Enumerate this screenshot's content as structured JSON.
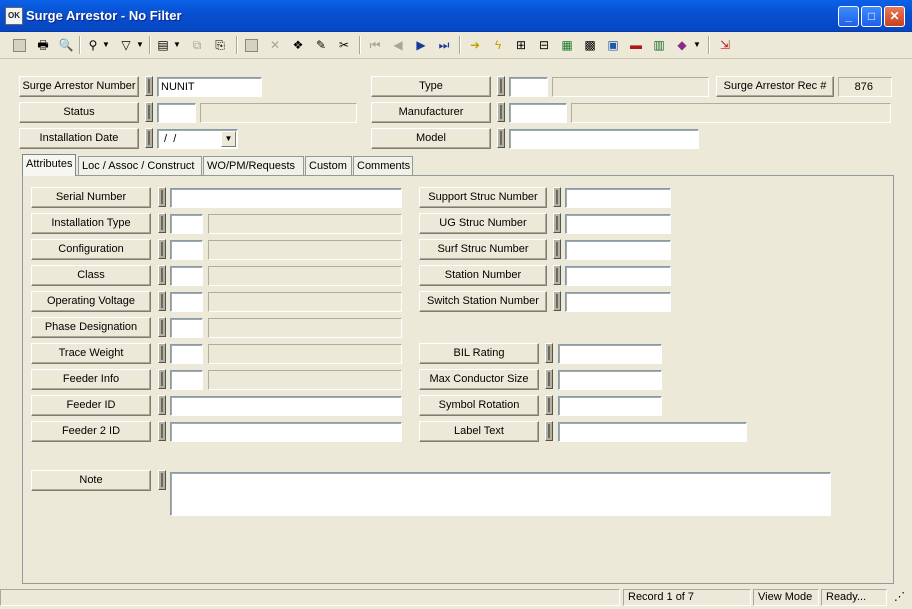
{
  "window": {
    "title": "Surge Arrestor - No Filter",
    "app_icon_text": "OK"
  },
  "header": {
    "surge_arrestor_number": {
      "label": "Surge Arrestor Number",
      "value": "NUNIT"
    },
    "status": {
      "label": "Status",
      "code": "",
      "desc": ""
    },
    "installation_date": {
      "label": "Installation Date",
      "value": " /  /"
    },
    "type": {
      "label": "Type",
      "code": "",
      "desc": ""
    },
    "manufacturer": {
      "label": "Manufacturer",
      "code": "",
      "desc": ""
    },
    "model": {
      "label": "Model",
      "value": ""
    },
    "rec_number": {
      "label": "Surge Arrestor Rec #",
      "value": "876"
    }
  },
  "tabs": [
    {
      "label": "Attributes",
      "active": true
    },
    {
      "label": "Loc / Assoc / Construct"
    },
    {
      "label": "WO/PM/Requests"
    },
    {
      "label": "Custom"
    },
    {
      "label": "Comments"
    }
  ],
  "attributes": {
    "serial_number": {
      "label": "Serial Number",
      "value": ""
    },
    "installation_type": {
      "label": "Installation Type",
      "code": "",
      "desc": ""
    },
    "configuration": {
      "label": "Configuration",
      "code": "",
      "desc": ""
    },
    "class": {
      "label": "Class",
      "code": "",
      "desc": ""
    },
    "operating_voltage": {
      "label": "Operating Voltage",
      "code": "",
      "desc": ""
    },
    "phase_designation": {
      "label": "Phase Designation",
      "code": "",
      "desc": ""
    },
    "trace_weight": {
      "label": "Trace Weight",
      "code": "",
      "desc": ""
    },
    "feeder_info": {
      "label": "Feeder Info",
      "code": "",
      "desc": ""
    },
    "feeder_id": {
      "label": "Feeder ID",
      "value": ""
    },
    "feeder_2_id": {
      "label": "Feeder 2 ID",
      "value": ""
    },
    "support_struc_number": {
      "label": "Support Struc Number",
      "value": ""
    },
    "ug_struc_number": {
      "label": "UG Struc Number",
      "value": ""
    },
    "surf_struc_number": {
      "label": "Surf Struc Number",
      "value": ""
    },
    "station_number": {
      "label": "Station Number",
      "value": ""
    },
    "switch_station_number": {
      "label": "Switch Station Number",
      "value": ""
    },
    "bil_rating": {
      "label": "BIL Rating",
      "value": ""
    },
    "max_conductor_size": {
      "label": "Max Conductor Size",
      "value": ""
    },
    "symbol_rotation": {
      "label": "Symbol Rotation",
      "value": ""
    },
    "label_text": {
      "label": "Label Text",
      "value": ""
    },
    "note": {
      "label": "Note",
      "value": ""
    }
  },
  "status_bar": {
    "record": "Record 1 of 7",
    "mode": "View Mode",
    "state": "Ready..."
  },
  "colors": {
    "title_bar": "#0a61e8",
    "face": "#ece9d8"
  }
}
